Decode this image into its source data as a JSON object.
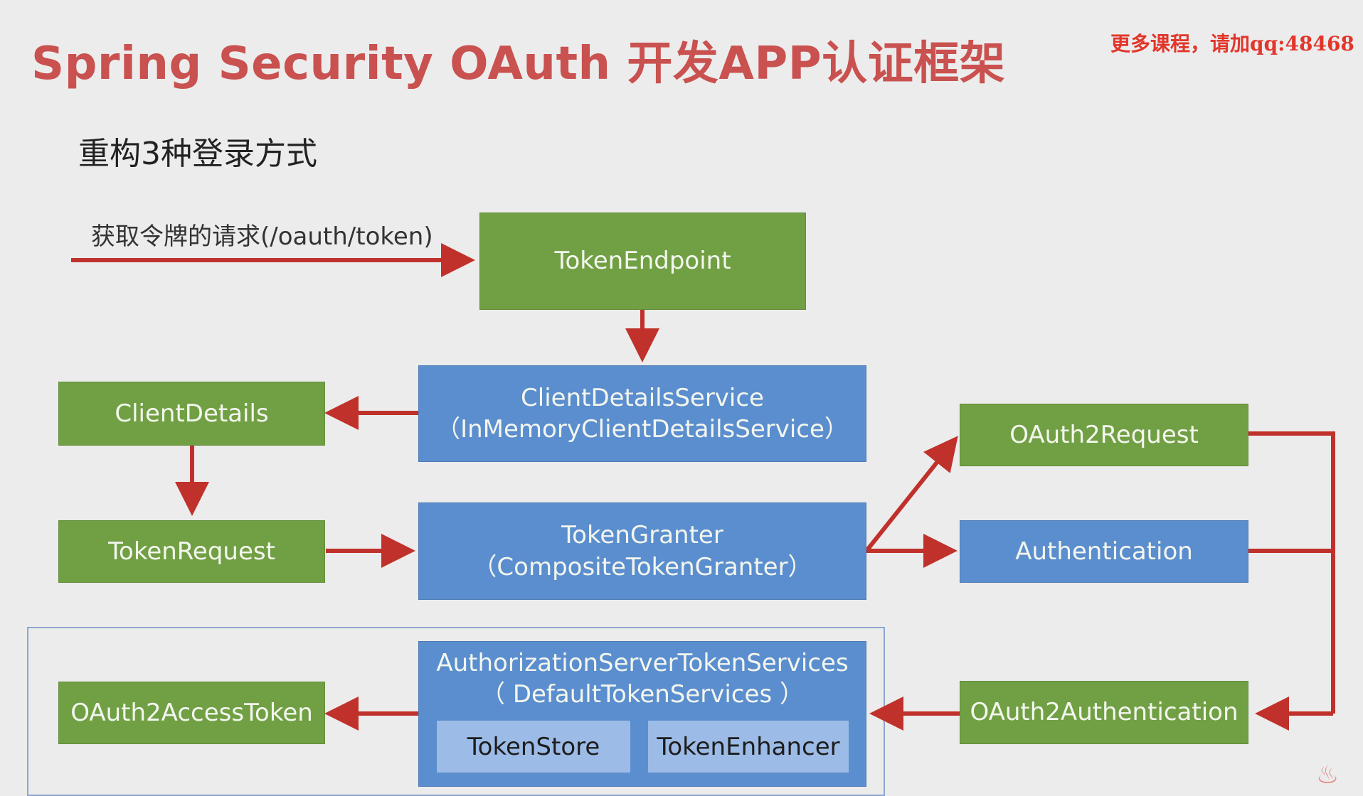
{
  "title": "Spring Security OAuth 开发APP认证框架",
  "watermark": "更多课程，请加qq:48468",
  "subtitle": "重构3种登录方式",
  "request_label": "获取令牌的请求(/oauth/token)",
  "nodes": {
    "token_endpoint": "TokenEndpoint",
    "client_details_service": [
      "ClientDetailsService",
      "（InMemoryClientDetailsService）"
    ],
    "client_details": "ClientDetails",
    "token_request": "TokenRequest",
    "token_granter": [
      "TokenGranter",
      "（CompositeTokenGranter）"
    ],
    "oauth2_request": "OAuth2Request",
    "authentication": "Authentication",
    "oauth2_authentication": "OAuth2Authentication",
    "token_services": [
      "AuthorizationServerTokenServices",
      "（ DefaultTokenServices ）"
    ],
    "token_store": "TokenStore",
    "token_enhancer": "TokenEnhancer",
    "oauth2_access_token": "OAuth2AccessToken"
  },
  "colors": {
    "title": "#c9514f",
    "green_box": "#71a044",
    "blue_box": "#5b8ece",
    "inner_box": "#9cbbe6",
    "arrow": "#c0312b",
    "background": "#ececec"
  }
}
